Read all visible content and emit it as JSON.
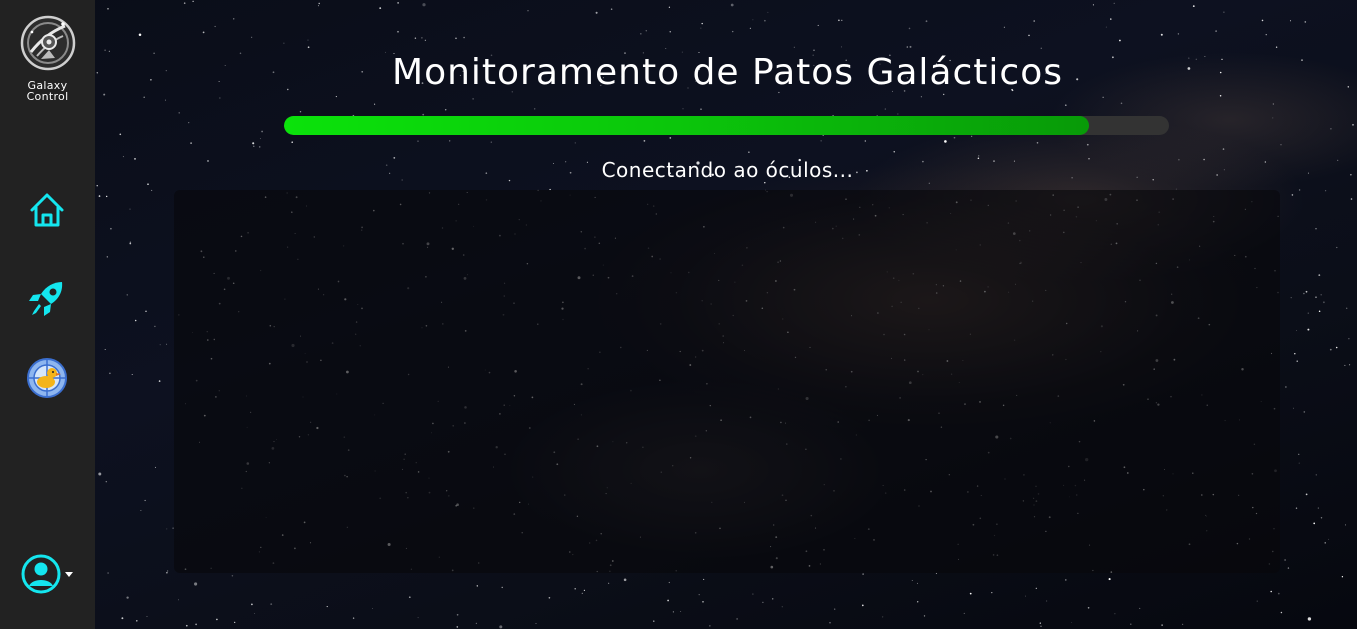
{
  "sidebar": {
    "logo_label": "Galaxy Control",
    "logo_icon": "galaxy-control-logo",
    "items": [
      {
        "name": "home",
        "icon": "home-icon"
      },
      {
        "name": "rocket",
        "icon": "rocket-icon"
      },
      {
        "name": "duck-radar",
        "icon": "duck-target-icon"
      }
    ],
    "user_icon": "user-circle-icon",
    "accent_color": "#14e6ef"
  },
  "main": {
    "title": "Monitoramento de Patos Galácticos",
    "progress": 0.91,
    "progress_color": "#0be20b",
    "status_text": "Conectando ao óculos..."
  }
}
